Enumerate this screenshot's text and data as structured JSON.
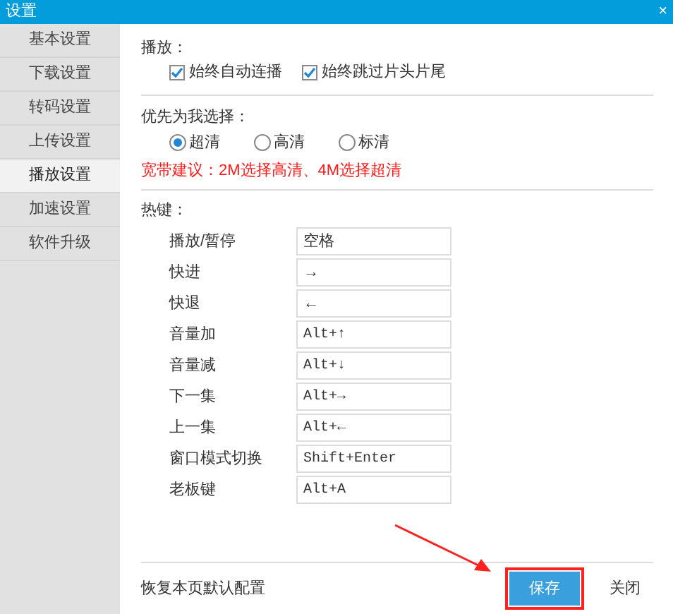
{
  "window": {
    "title": "设置",
    "close": "×"
  },
  "sidebar": {
    "items": [
      {
        "label": "基本设置",
        "selected": false
      },
      {
        "label": "下载设置",
        "selected": false
      },
      {
        "label": "转码设置",
        "selected": false
      },
      {
        "label": "上传设置",
        "selected": false
      },
      {
        "label": "播放设置",
        "selected": true
      },
      {
        "label": "加速设置",
        "selected": false
      },
      {
        "label": "软件升级",
        "selected": false
      }
    ]
  },
  "playback": {
    "title": "播放：",
    "options": [
      {
        "label": "始终自动连播",
        "checked": true
      },
      {
        "label": "始终跳过片头片尾",
        "checked": true
      }
    ]
  },
  "quality": {
    "title": "优先为我选择：",
    "options": [
      {
        "label": "超清",
        "selected": true
      },
      {
        "label": "高清",
        "selected": false
      },
      {
        "label": "标清",
        "selected": false
      }
    ],
    "hint": "宽带建议：2M选择高清、4M选择超清"
  },
  "hotkeys": {
    "title": "热键：",
    "rows": [
      {
        "label": "播放/暂停",
        "value": "空格",
        "kind": "text"
      },
      {
        "label": "快进",
        "value": "→",
        "kind": "text"
      },
      {
        "label": "快退",
        "value": "←",
        "kind": "text"
      },
      {
        "label": "音量加",
        "value": "Alt+↑",
        "kind": "combo"
      },
      {
        "label": "音量减",
        "value": "Alt+↓",
        "kind": "combo"
      },
      {
        "label": "下一集",
        "value": "Alt+→",
        "kind": "combo"
      },
      {
        "label": "上一集",
        "value": "Alt+←",
        "kind": "combo"
      },
      {
        "label": "窗口模式切换",
        "value": "Shift+Enter",
        "kind": "combo"
      },
      {
        "label": "老板键",
        "value": "Alt+A",
        "kind": "combo"
      }
    ]
  },
  "footer": {
    "restore_link": "恢复本页默认配置",
    "buttons": [
      {
        "label": "保存",
        "kind": "primary"
      },
      {
        "label": "关闭",
        "kind": "plain"
      }
    ]
  }
}
